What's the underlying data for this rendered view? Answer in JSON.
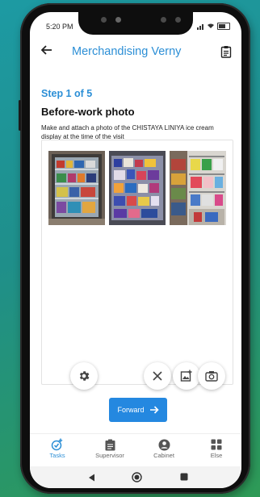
{
  "status_bar": {
    "time": "5:20 PM"
  },
  "header": {
    "title": "Merchandising Verny"
  },
  "step": {
    "label": "Step 1 of 5"
  },
  "section": {
    "heading": "Before-work photo",
    "description": "Make and attach a photo of the CHISTAYA LINIYA ice cream display at the time of the visit"
  },
  "photos": [
    {
      "name": "photo-1"
    },
    {
      "name": "photo-2"
    },
    {
      "name": "photo-3"
    }
  ],
  "actions": {
    "forward_label": "Forward"
  },
  "tabs": [
    {
      "label": "Tasks",
      "icon": "tasks-icon",
      "active": true
    },
    {
      "label": "Supervisor",
      "icon": "clipboard-icon",
      "active": false
    },
    {
      "label": "Cabinet",
      "icon": "person-icon",
      "active": false
    },
    {
      "label": "Else",
      "icon": "grid-icon",
      "active": false
    }
  ],
  "colors": {
    "accent": "#2c8fd6",
    "button": "#2488e0"
  }
}
